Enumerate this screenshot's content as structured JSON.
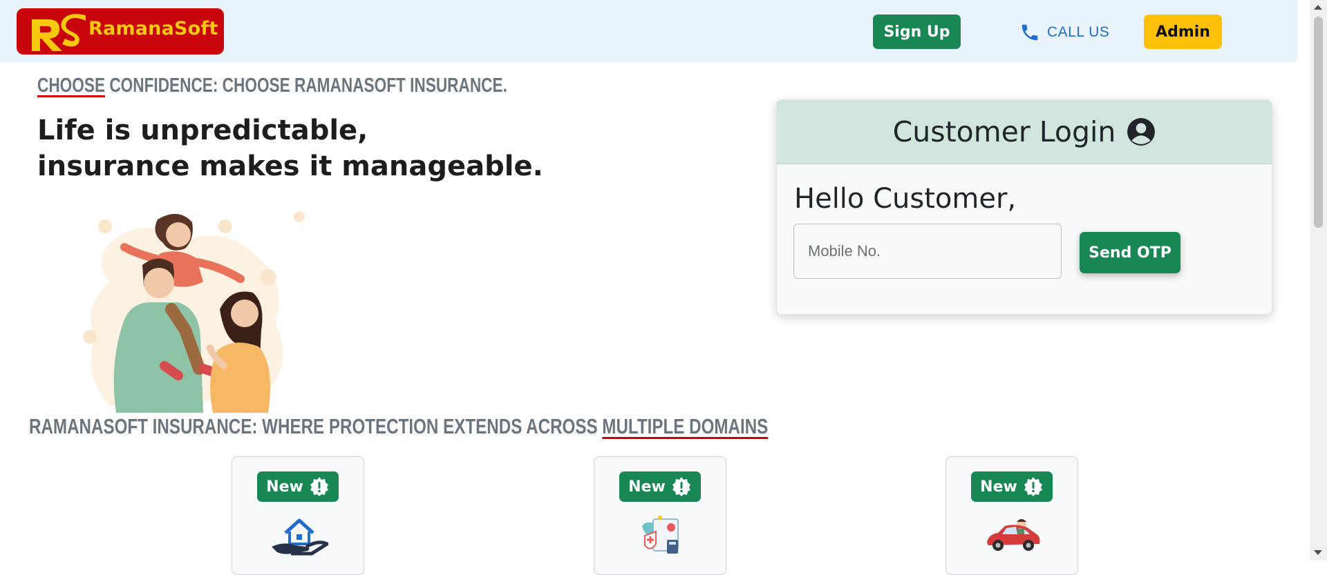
{
  "navbar": {
    "brand": "RamanaSoft",
    "signup_label": "Sign Up",
    "call_label": "CALL US",
    "admin_label": "Admin"
  },
  "hero": {
    "tagline_underlined": "CHOOSE",
    "tagline_rest": " CONFIDENCE: CHOOSE RAMANASOFT INSURANCE.",
    "title_line1": "Life is unpredictable,",
    "title_line2": "insurance makes it manageable."
  },
  "login": {
    "title": "Customer Login",
    "greeting": "Hello Customer,",
    "mobile_placeholder": "Mobile No.",
    "otp_button": "Send OTP"
  },
  "domains": {
    "title_plain": "RAMANASOFT INSURANCE: WHERE PROTECTION EXTENDS ACROSS ",
    "title_underlined": "MULTIPLE DOMAINS",
    "cards": [
      {
        "badge": "New",
        "icon": "home-insurance-icon"
      },
      {
        "badge": "New",
        "icon": "health-insurance-icon"
      },
      {
        "badge": "New",
        "icon": "car-insurance-icon"
      }
    ]
  },
  "colors": {
    "primary_green": "#198754",
    "brand_red": "#c8050b",
    "brand_yellow": "#f6c90e",
    "admin_yellow": "#ffc107",
    "navbar_bg": "#e9f3fc"
  }
}
